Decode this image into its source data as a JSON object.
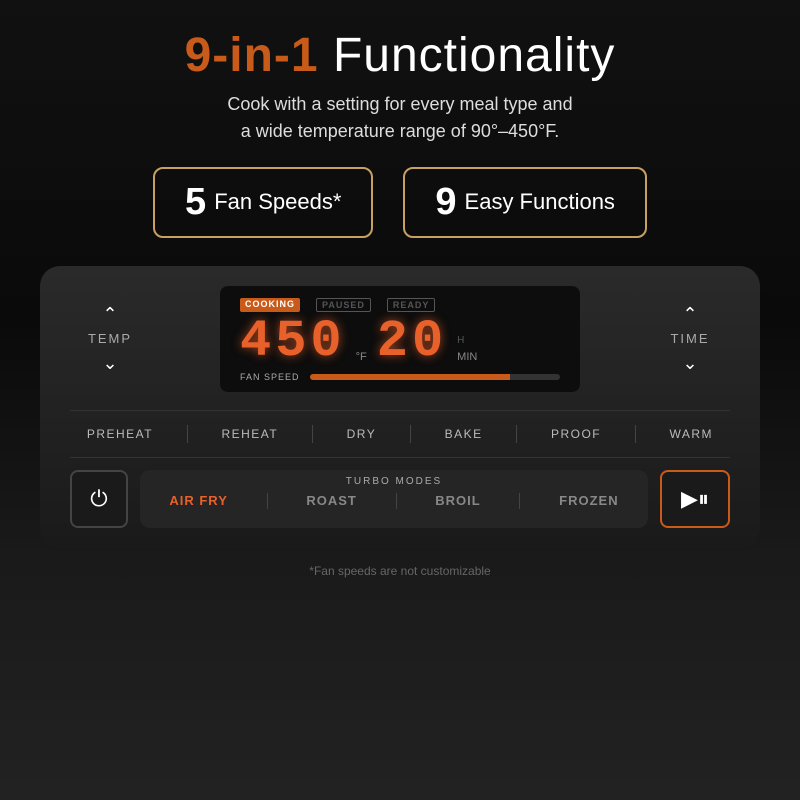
{
  "header": {
    "title_prefix": "9-in-1",
    "title_suffix": " Functionality",
    "subtitle_line1": "Cook with a setting for every meal type and",
    "subtitle_line2": "a wide temperature range of 90°–450°F."
  },
  "badges": [
    {
      "id": "fan-speeds",
      "number": "5",
      "label": "Fan Speeds*"
    },
    {
      "id": "easy-functions",
      "number": "9",
      "label": "Easy Functions"
    }
  ],
  "controls": {
    "temp_label": "TEMP",
    "time_label": "TIME"
  },
  "display": {
    "status_cooking": "COOKING",
    "status_paused": "PAUSED",
    "status_ready": "READY",
    "temperature": "450",
    "temp_unit": "°F",
    "time": "20",
    "time_unit": "MIN",
    "h_unit": "H",
    "fan_speed_label": "FAN SPEED"
  },
  "functions": [
    "PREHEAT",
    "REHEAT",
    "DRY",
    "BAKE",
    "PROOF",
    "WARM"
  ],
  "turbo": {
    "label": "TURBO MODES",
    "modes": [
      {
        "id": "air-fry",
        "label": "AIR FRY",
        "active": true
      },
      {
        "id": "roast",
        "label": "ROAST",
        "active": false
      },
      {
        "id": "broil",
        "label": "BROIL",
        "active": false
      },
      {
        "id": "frozen",
        "label": "FROZEN",
        "active": false
      }
    ]
  },
  "footnote": "*Fan speeds are not customizable"
}
